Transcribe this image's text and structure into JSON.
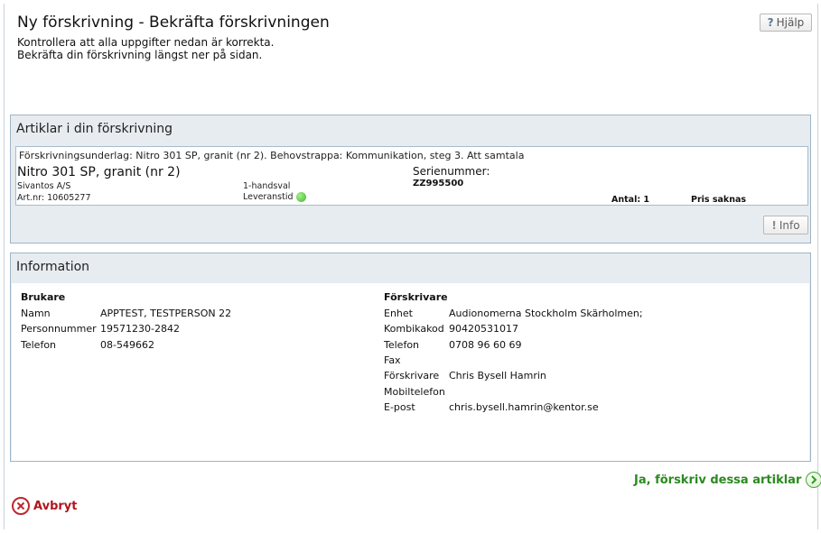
{
  "page": {
    "title": "Ny förskrivning - Bekräfta förskrivningen",
    "intro_line1": "Kontrollera att alla uppgifter nedan är korrekta.",
    "intro_line2": "Bekräfta din förskrivning längst ner på sidan.",
    "help_label": "Hjälp"
  },
  "articles_panel": {
    "title": "Artiklar i din förskrivning",
    "article": {
      "basis": "Förskrivningsunderlag: Nitro 301 SP, granit (nr 2). Behovstrappa: Kommunikation, steg 3. Att samtala",
      "name": "Nitro 301 SP, granit (nr 2)",
      "manufacturer": "Sivantos A/S",
      "article_number": "Art.nr: 10605277",
      "choice": "1-handsval",
      "delivery_label": "Leveranstid",
      "delivery_status_color": "#3fb82a",
      "serial_label": "Serienummer:",
      "serial_value": "ZZ995500",
      "quantity": "Antal: 1",
      "price": "Pris saknas"
    },
    "info_button_label": "Info"
  },
  "information_panel": {
    "title": "Information",
    "user": {
      "heading": "Brukare",
      "rows": [
        {
          "label": "Namn",
          "value": "APPTEST, TESTPERSON 22"
        },
        {
          "label": "Personnummer",
          "value": "19571230-2842"
        },
        {
          "label": "Telefon",
          "value": "08-549662"
        }
      ]
    },
    "prescriber": {
      "heading": "Förskrivare",
      "rows": [
        {
          "label": "Enhet",
          "value": "Audionomerna Stockholm Skärholmen;"
        },
        {
          "label": "Kombikakod",
          "value": "90420531017"
        },
        {
          "label": "Telefon",
          "value": "0708 96 60 69"
        },
        {
          "label": "Fax",
          "value": ""
        },
        {
          "label": "Förskrivare",
          "value": "Chris Bysell Hamrin"
        },
        {
          "label": "Mobiltelefon",
          "value": ""
        },
        {
          "label": "E-post",
          "value": "chris.bysell.hamrin@kentor.se"
        }
      ]
    }
  },
  "actions": {
    "confirm_label": "Ja, förskriv dessa artiklar",
    "cancel_label": "Avbryt"
  },
  "colors": {
    "panel_border": "#9fb4c6",
    "panel_background": "#e7ecf0",
    "confirm_green": "#2a8a1f",
    "cancel_red": "#b0151d"
  }
}
